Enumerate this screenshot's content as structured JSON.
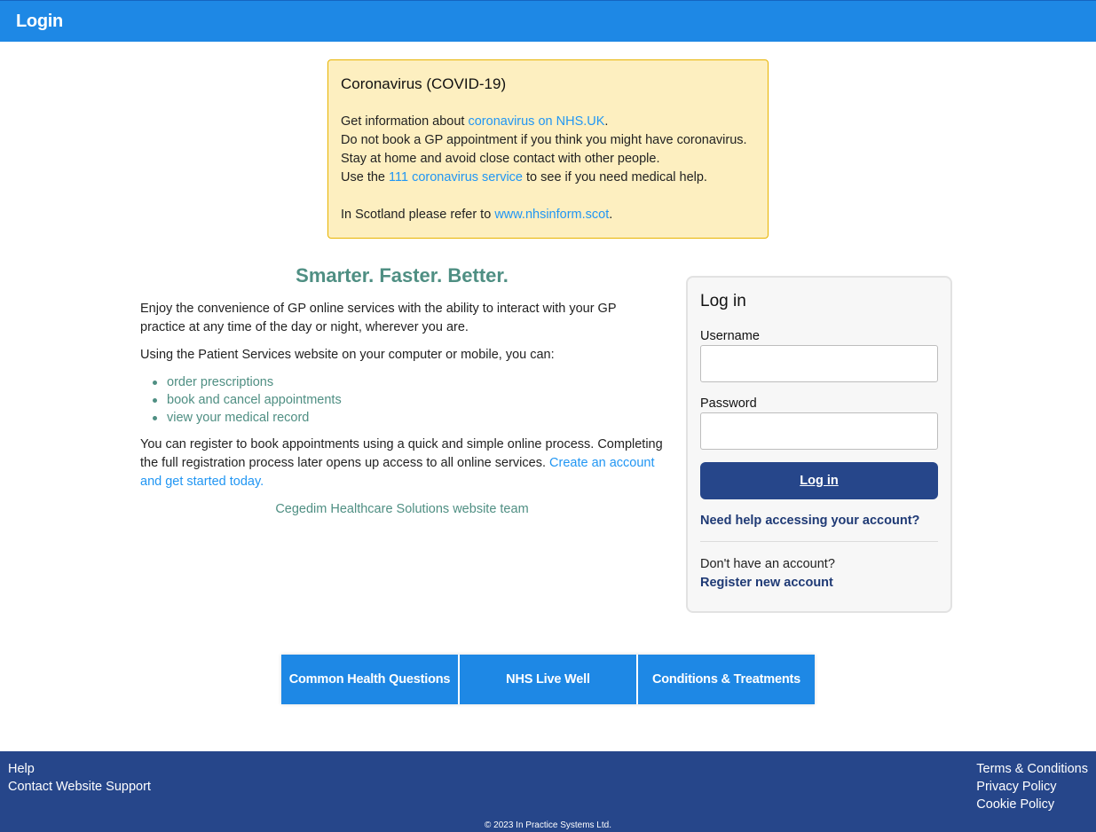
{
  "header": {
    "title": "Login"
  },
  "covid": {
    "heading": "Coronavirus (COVID-19)",
    "line1_pre": "Get information about ",
    "line1_link": "coronavirus on NHS.UK",
    "line1_post": ".",
    "line2": "Do not book a GP appointment if you think you might have coronavirus.",
    "line3": "Stay at home and avoid close contact with other people.",
    "line4_pre": "Use the ",
    "line4_link": "111 coronavirus service",
    "line4_post": " to see if you need medical help.",
    "line5_pre": "In Scotland please refer to ",
    "line5_link": "www.nhsinform.scot",
    "line5_post": "."
  },
  "intro": {
    "heading": "Smarter. Faster. Better.",
    "para1": "Enjoy the convenience of GP online services with the ability to interact with your GP practice at any time of the day or night, wherever you are.",
    "para2": "Using the Patient Services website on your computer or mobile, you can:",
    "features": [
      "order prescriptions",
      "book and cancel appointments",
      "view your medical record"
    ],
    "para3": "You can register to book appointments using a quick and simple online process. Completing the full registration process later opens up access to all online services. ",
    "para3_link": "Create an account and get started today.",
    "signature": "Cegedim Healthcare Solutions website team"
  },
  "login": {
    "heading": "Log in",
    "username_label": "Username",
    "username_value": "",
    "password_label": "Password",
    "password_value": "",
    "submit_label": "Log in",
    "help_link": "Need help accessing your account?",
    "no_account": "Don't have an account?",
    "register_link": "Register new account"
  },
  "tiles": [
    "Common Health Questions",
    "NHS Live Well",
    "Conditions & Treatments"
  ],
  "footer": {
    "left_links": [
      "Help",
      "Contact Website Support"
    ],
    "right_links": [
      "Terms & Conditions",
      "Privacy Policy",
      "Cookie Policy"
    ],
    "copyright": "© 2023 In Practice Systems Ltd."
  },
  "colors": {
    "header_bg": "#1e88e5",
    "footer_bg": "#26468a",
    "accent_green": "#4f8f83",
    "link_blue": "#2196f3",
    "covid_bg": "#fdefc0"
  }
}
